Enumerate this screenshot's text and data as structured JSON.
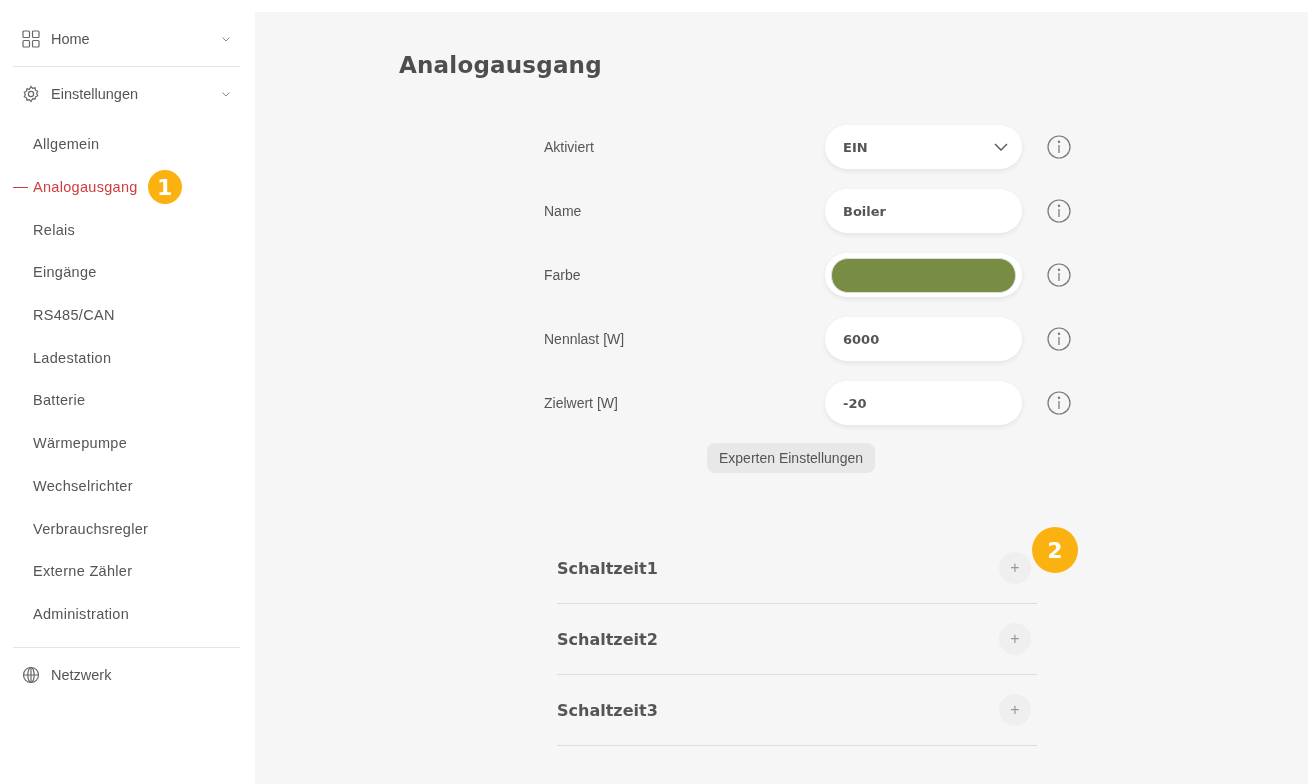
{
  "sidebar": {
    "sections": [
      {
        "label": "Home",
        "kind": "grid",
        "expandable": true
      },
      {
        "label": "Einstellungen",
        "kind": "gear",
        "expandable": true,
        "items": [
          {
            "label": "Allgemein",
            "selected": false
          },
          {
            "label": "Analogausgang",
            "selected": true,
            "badge": "1"
          },
          {
            "label": "Relais",
            "selected": false
          },
          {
            "label": "Eingänge",
            "selected": false
          },
          {
            "label": "RS485/CAN",
            "selected": false
          },
          {
            "label": "Ladestation",
            "selected": false
          },
          {
            "label": "Batterie",
            "selected": false
          },
          {
            "label": "Wärmepumpe",
            "selected": false
          },
          {
            "label": "Wechselrichter",
            "selected": false
          },
          {
            "label": "Verbrauchsregler",
            "selected": false
          },
          {
            "label": "Externe Zähler",
            "selected": false
          },
          {
            "label": "Administration",
            "selected": false
          }
        ]
      },
      {
        "label": "Netzwerk",
        "kind": "globe",
        "expandable": false
      }
    ]
  },
  "page": {
    "title": "Analogausgang"
  },
  "form": {
    "fields": [
      {
        "label": "Aktiviert",
        "kind": "select",
        "value": "EIN"
      },
      {
        "label": "Name",
        "kind": "text",
        "value": "Boiler"
      },
      {
        "label": "Farbe",
        "kind": "color",
        "color": "#788c43"
      },
      {
        "label": "Nennlast [W]",
        "kind": "text",
        "value": "6000"
      },
      {
        "label": "Zielwert [W]",
        "kind": "text",
        "value": "-20"
      }
    ],
    "expert_button": "Experten Einstellungen"
  },
  "schedules": [
    {
      "title": "Schaltzeit1",
      "toggle": "+",
      "badge": "2"
    },
    {
      "title": "Schaltzeit2",
      "toggle": "+"
    },
    {
      "title": "Schaltzeit3",
      "toggle": "+"
    }
  ]
}
